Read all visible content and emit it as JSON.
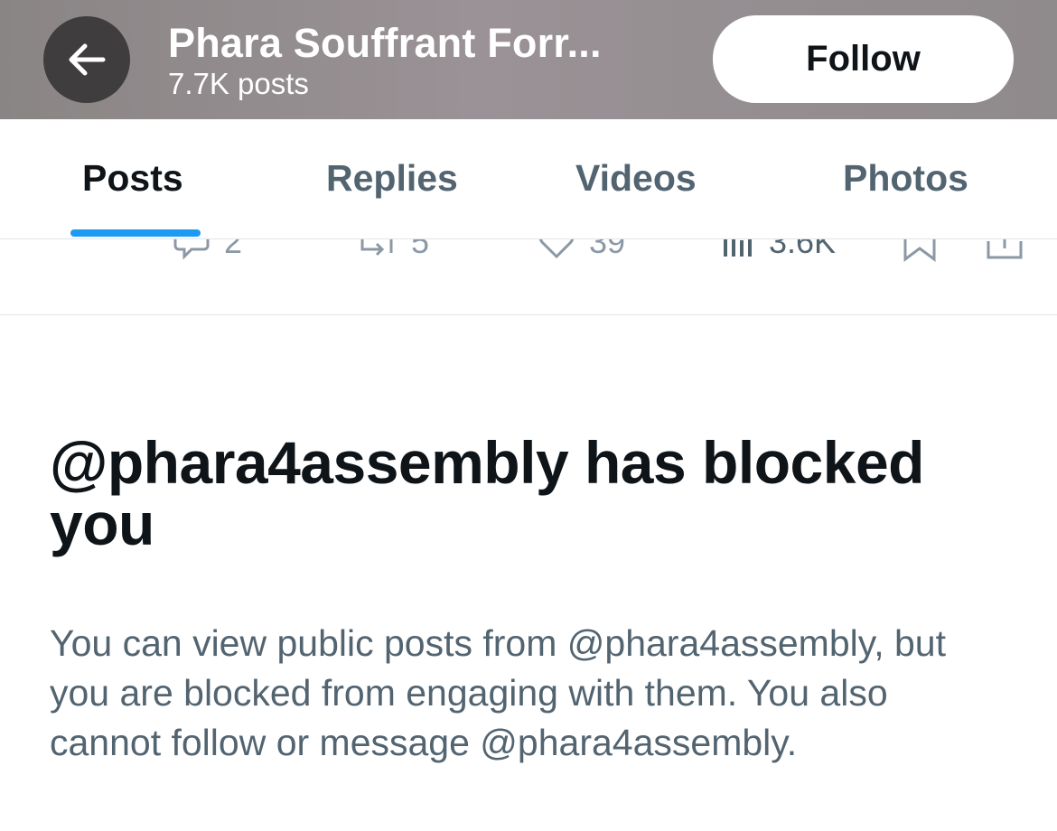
{
  "header": {
    "back_icon": "arrow-left-icon",
    "title": "Phara Souffrant Forr...",
    "subtitle": "7.7K posts",
    "follow_label": "Follow",
    "background_color": "#908a8d"
  },
  "tabs": [
    {
      "label": "Posts",
      "active": true
    },
    {
      "label": "Replies",
      "active": false
    },
    {
      "label": "Videos",
      "active": false
    },
    {
      "label": "Photos",
      "active": false
    }
  ],
  "accent_color": "#1d9bf0",
  "post_actions": {
    "reply_count": "2",
    "repost_count": "5",
    "like_count": "39",
    "views_count": "3.6K",
    "icons": [
      "reply-icon",
      "repost-icon",
      "like-icon",
      "views-icon",
      "bookmark-icon",
      "share-icon"
    ]
  },
  "blocked": {
    "title": "@phara4assembly has blocked you",
    "description": "You can view public posts from @phara4assembly, but you are blocked from engaging with them. You also cannot follow or message @phara4assembly."
  }
}
